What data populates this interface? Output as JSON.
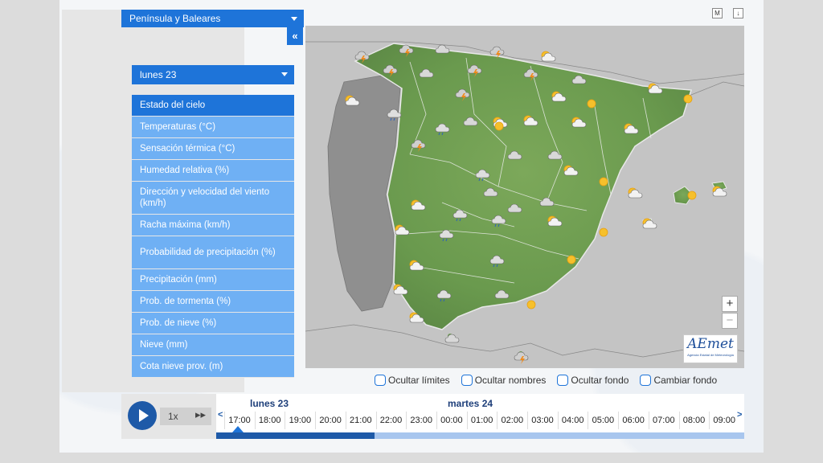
{
  "region_select": {
    "label": "Península y Baleares"
  },
  "collapse_label": "«",
  "day_select": {
    "label": "lunes 23"
  },
  "menu": [
    {
      "label": "Estado del cielo",
      "active": true
    },
    {
      "label": "Temperaturas (°C)"
    },
    {
      "label": "Sensación térmica (°C)"
    },
    {
      "label": "Humedad relativa (%)"
    },
    {
      "label": "Dirección y velocidad del viento (km/h)"
    },
    {
      "label": "Racha máxima (km/h)"
    },
    {
      "label": "Probabilidad de precipitación (%)"
    },
    {
      "label": "Precipitación (mm)"
    },
    {
      "label": "Prob. de tormenta (%)"
    },
    {
      "label": "Prob. de nieve (%)"
    },
    {
      "label": "Nieve (mm)"
    },
    {
      "label": "Cota nieve prov. (m)"
    }
  ],
  "map": {
    "zoom_in": "+",
    "zoom_out": "−",
    "logo_text": "AEmet",
    "logo_sub": "Agencia Estatal de Meteorología",
    "icon_m": "M",
    "icon_download": "↓"
  },
  "options": {
    "hide_limits": "Ocultar límites",
    "hide_names": "Ocultar nombres",
    "hide_background": "Ocultar fondo",
    "change_background": "Cambiar fondo"
  },
  "timeline": {
    "speed": "1x",
    "fast_forward": "▸▸",
    "day1": "lunes 23",
    "day2": "martes 24",
    "prev": "<",
    "next": ">",
    "hours": [
      "17:00",
      "18:00",
      "19:00",
      "20:00",
      "21:00",
      "22:00",
      "23:00",
      "00:00",
      "01:00",
      "02:00",
      "03:00",
      "04:00",
      "05:00",
      "06:00",
      "07:00",
      "08:00",
      "09:00"
    ],
    "progress_fraction": 0.3
  },
  "weather_icons": [
    {
      "type": "storm"
    },
    {
      "type": "storm"
    },
    {
      "type": "cloud"
    },
    {
      "type": "storm"
    },
    {
      "type": "sun-cloud"
    },
    {
      "type": "storm"
    },
    {
      "type": "cloud"
    },
    {
      "type": "storm"
    },
    {
      "type": "storm"
    },
    {
      "type": "cloud"
    },
    {
      "type": "sun-cloud"
    },
    {
      "type": "rain"
    },
    {
      "type": "storm"
    },
    {
      "type": "sun-cloud"
    },
    {
      "type": "sun"
    },
    {
      "type": "sun-cloud"
    },
    {
      "type": "sun"
    },
    {
      "type": "sun-cloud"
    },
    {
      "type": "sun-cloud"
    },
    {
      "type": "rain"
    },
    {
      "type": "storm"
    },
    {
      "type": "cloud"
    },
    {
      "type": "sun-cloud"
    },
    {
      "type": "sun"
    },
    {
      "type": "sun-cloud"
    },
    {
      "type": "cloud"
    },
    {
      "type": "cloud"
    },
    {
      "type": "rain"
    },
    {
      "type": "sun-cloud"
    },
    {
      "type": "sun"
    },
    {
      "type": "cloud"
    },
    {
      "type": "cloud"
    },
    {
      "type": "sun-cloud"
    },
    {
      "type": "sun"
    },
    {
      "type": "sun-cloud"
    },
    {
      "type": "sun-cloud"
    },
    {
      "type": "rain"
    },
    {
      "type": "rain"
    },
    {
      "type": "cloud"
    },
    {
      "type": "sun-cloud"
    },
    {
      "type": "sun-cloud"
    },
    {
      "type": "sun"
    },
    {
      "type": "sun-cloud"
    },
    {
      "type": "rain"
    },
    {
      "type": "rain"
    },
    {
      "type": "sun-cloud"
    },
    {
      "type": "sun"
    },
    {
      "type": "sun-cloud"
    },
    {
      "type": "rain"
    },
    {
      "type": "cloud"
    },
    {
      "type": "sun"
    },
    {
      "type": "sun-cloud"
    },
    {
      "type": "cloud"
    },
    {
      "type": "storm"
    }
  ]
}
